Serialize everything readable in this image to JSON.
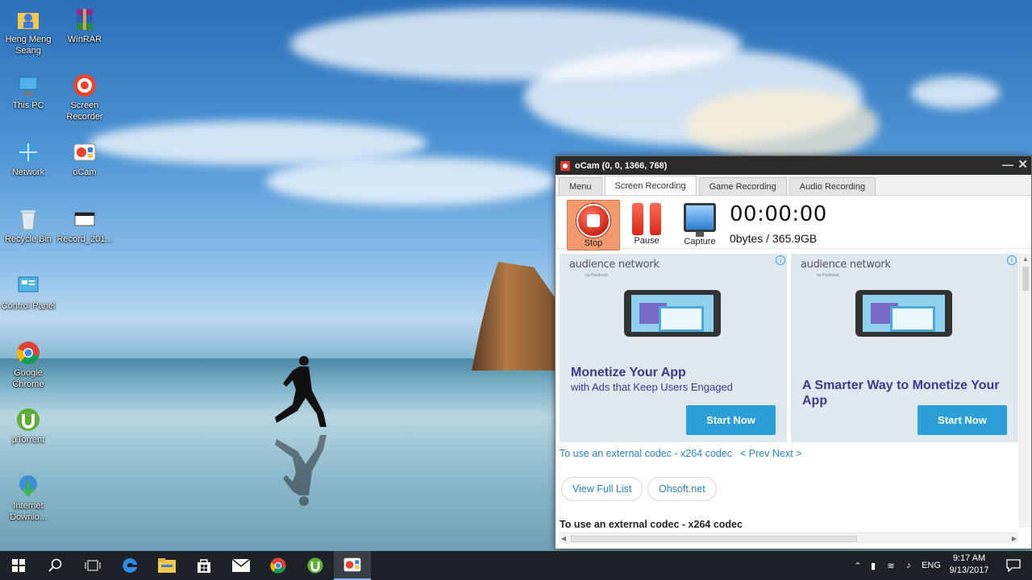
{
  "desktop": {
    "icons": [
      {
        "name": "Heng Meng Seang",
        "icon": "user-folder-icon"
      },
      {
        "name": "WinRAR",
        "icon": "winrar-icon"
      },
      {
        "name": "This PC",
        "icon": "computer-icon"
      },
      {
        "name": "Screen Recorder",
        "icon": "screen-recorder-icon"
      },
      {
        "name": "Network",
        "icon": "network-icon"
      },
      {
        "name": "oCam",
        "icon": "ocam-icon"
      },
      {
        "name": "Recycle Bin",
        "icon": "recycle-bin-icon"
      },
      {
        "name": "Record_201...",
        "icon": "file-icon"
      },
      {
        "name": "Control Panel",
        "icon": "control-panel-icon"
      },
      {
        "name": "Google Chrome",
        "icon": "chrome-icon"
      },
      {
        "name": "µTorrent",
        "icon": "utorrent-icon"
      },
      {
        "name": "Internet Downlo...",
        "icon": "internet-download-icon"
      }
    ]
  },
  "ocam": {
    "title": "oCam (0, 0, 1366, 768)",
    "tabs": [
      "Menu",
      "Screen Recording",
      "Game Recording",
      "Audio Recording"
    ],
    "active_tab": "Screen Recording",
    "tools": {
      "stop": "Stop",
      "pause": "Pause",
      "capture": "Capture"
    },
    "timer": "00:00:00",
    "size": "0bytes / 365.9GB",
    "ads": [
      {
        "brand": "audience network",
        "brand_sub": "by Facebook",
        "headline": "Monetize Your App",
        "sub": "with Ads that Keep Users Engaged",
        "cta": "Start Now"
      },
      {
        "brand": "audience network",
        "brand_sub": "by Facebook",
        "headline": "A Smarter Way to Monetize Your App",
        "sub": "",
        "cta": "Start Now"
      }
    ],
    "codec_link": "To use an external codec - x264 codec",
    "prev_next": "< Prev Next >",
    "view_full_list": "View Full List",
    "ohsoft": "Ohsoft.net",
    "codec_bottom": "To use an external codec - x264 codec"
  },
  "taskbar": {
    "apps": [
      "windows-start-icon",
      "search-icon",
      "task-view-icon",
      "edge-icon",
      "file-explorer-icon",
      "store-icon",
      "mail-icon",
      "chrome-icon",
      "utorrent-icon",
      "ocam-icon"
    ],
    "language": "ENG",
    "time": "9:17 AM",
    "date": "9/13/2017"
  },
  "colors": {
    "accent": "#2ba0d8",
    "ad_text": "#3d3a8c",
    "link": "#2b82c7",
    "taskbar": "#1d2128",
    "stop_bg": "#f09a6d"
  }
}
